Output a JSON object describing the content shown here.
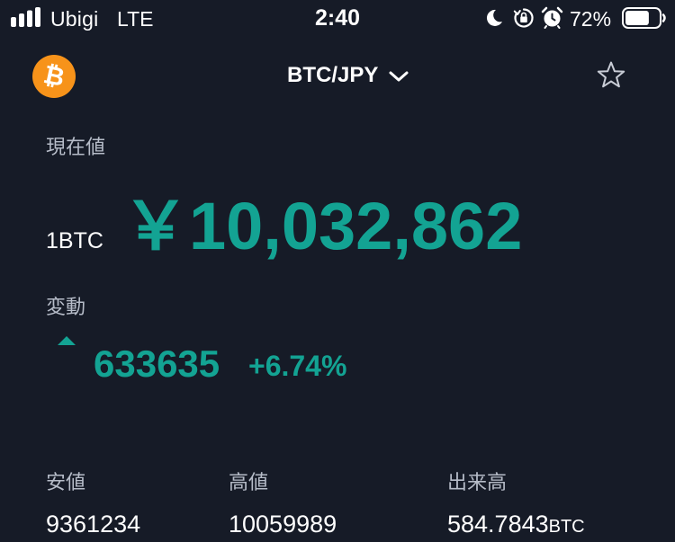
{
  "status_bar": {
    "carrier": "Ubigi",
    "network": "LTE",
    "time": "2:40",
    "battery_percent": "72%",
    "icons": [
      "signal-icon",
      "moon-icon",
      "rotation-lock-icon",
      "alarm-icon",
      "battery-icon"
    ],
    "battery_level": 0.72
  },
  "header": {
    "coin_icon": "bitcoin-icon",
    "coin_symbol": "₿",
    "pair": "BTC/JPY",
    "dropdown_icon": "chevron-down-icon",
    "favorite_icon": "star-icon"
  },
  "price": {
    "label": "現在値",
    "unit": "1BTC",
    "value": "￥10,032,862"
  },
  "change": {
    "label": "変動",
    "direction_icon": "up-triangle-icon",
    "amount": "633635",
    "percent": "+6.74%"
  },
  "stats": {
    "low": {
      "label": "安値",
      "value": "9361234"
    },
    "high": {
      "label": "高値",
      "value": "10059989"
    },
    "volume": {
      "label": "出来高",
      "value": "584.7843",
      "unit": "BTC"
    }
  },
  "colors": {
    "background": "#161b27",
    "accent_green": "#13a393",
    "bitcoin_orange": "#f7931a",
    "muted_text": "#b6bcc8",
    "text": "#ffffff"
  }
}
